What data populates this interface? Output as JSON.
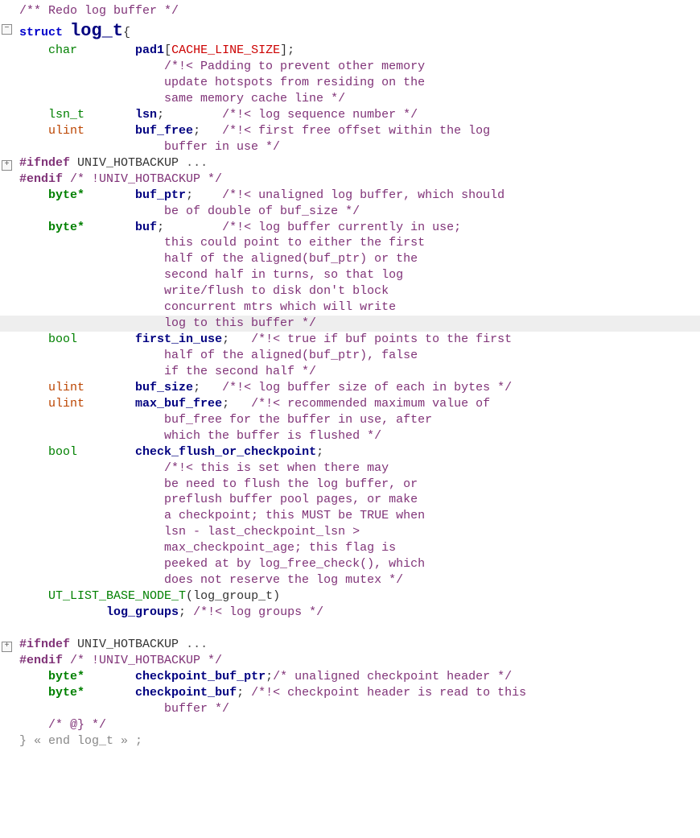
{
  "code": {
    "top_comment": "/** Redo log buffer */",
    "struct_kw": "struct",
    "struct_name": "log_t",
    "brace_open": "{",
    "f_char": "char",
    "f_pad1": "pad1",
    "f_pad1_arr_open": "[",
    "f_pad1_arr": "CACHE_LINE_SIZE",
    "f_pad1_arr_close": "];",
    "c_pad1_l1": "/*!< Padding to prevent other memory",
    "c_pad1_l2": "update hotspots from residing on the",
    "c_pad1_l3": "same memory cache line */",
    "t_lsn": "lsn_t",
    "f_lsn": "lsn",
    "c_lsn": "/*!< log sequence number */",
    "t_ulint": "ulint",
    "f_buf_free": "buf_free",
    "c_buf_free_l1": "/*!< first free offset within the log",
    "c_buf_free_l2": "buffer in use */",
    "pp_ifndef": "#ifndef",
    "pp_hot": "UNIV_HOTBACKUP",
    "pp_dots": "...",
    "pp_endif": "#endif",
    "pp_endif_c": "/* !UNIV_HOTBACKUP */",
    "t_bytep": "byte*",
    "f_buf_ptr": "buf_ptr",
    "c_buf_ptr_l1": "/*!< unaligned log buffer, which should",
    "c_buf_ptr_l2": "be of double of buf_size */",
    "f_buf": "buf",
    "c_buf_l1": "/*!< log buffer currently in use;",
    "c_buf_l2": "this could point to either the first",
    "c_buf_l3": "half of the aligned(buf_ptr) or the",
    "c_buf_l4": "second half in turns, so that log",
    "c_buf_l5": "write/flush to disk don't block",
    "c_buf_l6": "concurrent mtrs which will write",
    "c_buf_l7": "log to this buffer */",
    "t_bool": "bool",
    "f_first_in_use": "first_in_use",
    "c_fiu_l1": "/*!< true if buf points to the first",
    "c_fiu_l2": "half of the aligned(buf_ptr), false",
    "c_fiu_l3": "if the second half */",
    "f_buf_size": "buf_size",
    "c_buf_size": "/*!< log buffer size of each in bytes */",
    "f_max_buf_free": "max_buf_free",
    "c_mbf_l1": "/*!< recommended maximum value of",
    "c_mbf_l2": "buf_free for the buffer in use, after",
    "c_mbf_l3": "which the buffer is flushed */",
    "f_check_flush": "check_flush_or_checkpoint",
    "c_cfc_l1": "/*!< this is set when there may",
    "c_cfc_l2": "be need to flush the log buffer, or",
    "c_cfc_l3": "preflush buffer pool pages, or make",
    "c_cfc_l4": "a checkpoint; this MUST be TRUE when",
    "c_cfc_l5": "lsn - last_checkpoint_lsn >",
    "c_cfc_l6": "max_checkpoint_age; this flag is",
    "c_cfc_l7": "peeked at by log_free_check(), which",
    "c_cfc_l8": "does not reserve the log mutex */",
    "ut_macro": "UT_LIST_BASE_NODE_T",
    "ut_arg_open": "(",
    "ut_arg": "log_group_t",
    "ut_arg_close": ")",
    "f_log_groups": "log_groups",
    "c_log_groups": "/*!< log groups */",
    "f_checkpoint_buf_ptr": "checkpoint_buf_ptr",
    "c_cbp": "/* unaligned checkpoint header */",
    "f_checkpoint_buf": "checkpoint_buf",
    "c_cb_l1": "/*!< checkpoint header is read to this",
    "c_cb_l2": "buffer */",
    "c_at": "/* @} */",
    "end_l": "} « end log_t » ;"
  }
}
